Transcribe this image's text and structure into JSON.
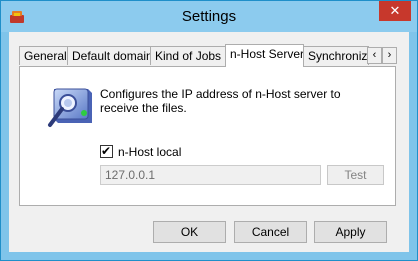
{
  "window": {
    "title": "Settings",
    "close_glyph": "✕"
  },
  "tabs": [
    {
      "label": "General"
    },
    {
      "label": "Default domain"
    },
    {
      "label": "Kind of Jobs"
    },
    {
      "label": "n-Host Server",
      "active": true
    },
    {
      "label": "Synchronize"
    }
  ],
  "tab_scroll": {
    "left": "‹",
    "right": "›"
  },
  "panel": {
    "description": "Configures the IP address of n-Host server to receive the files.",
    "checkbox": {
      "label": "n-Host local",
      "checked": true,
      "check_glyph": "✔"
    },
    "ip_field": {
      "value": "127.0.0.1",
      "disabled": true
    },
    "test_button": "Test"
  },
  "buttons": {
    "ok": "OK",
    "cancel": "Cancel",
    "apply": "Apply"
  },
  "colors": {
    "titlebar": "#8ccbee",
    "close": "#c7382c",
    "border": "#1f8fc9"
  }
}
